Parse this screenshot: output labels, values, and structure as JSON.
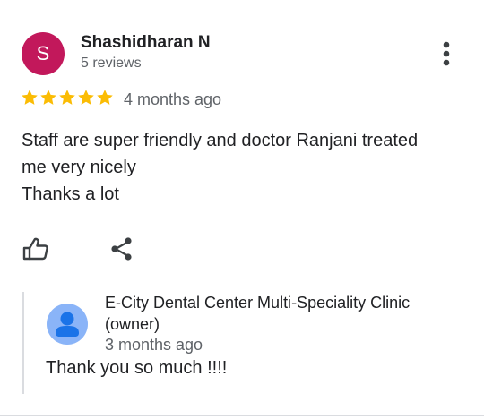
{
  "review": {
    "avatar_letter": "S",
    "avatar_color": "#c2185b",
    "reviewer_name": "Shashidharan N",
    "review_count": "5 reviews",
    "rating": 5,
    "max_rating": 5,
    "star_color": "#fbbc04",
    "time": "4 months ago",
    "text_lines": [
      "Staff are super friendly and doctor Ranjani treated",
      "me very nicely",
      "Thanks a lot"
    ]
  },
  "actions": {
    "like_icon": "thumbs-up-icon",
    "share_icon": "share-icon",
    "more_icon": "more-vert-icon"
  },
  "owner_reply": {
    "name": "E-City Dental Center Multi-Speciality Clinic (owner)",
    "time": "3 months ago",
    "text": "Thank you so much !!!!",
    "avatar_color": "#8ab4f8",
    "avatar_figure_color": "#1a73e8"
  }
}
